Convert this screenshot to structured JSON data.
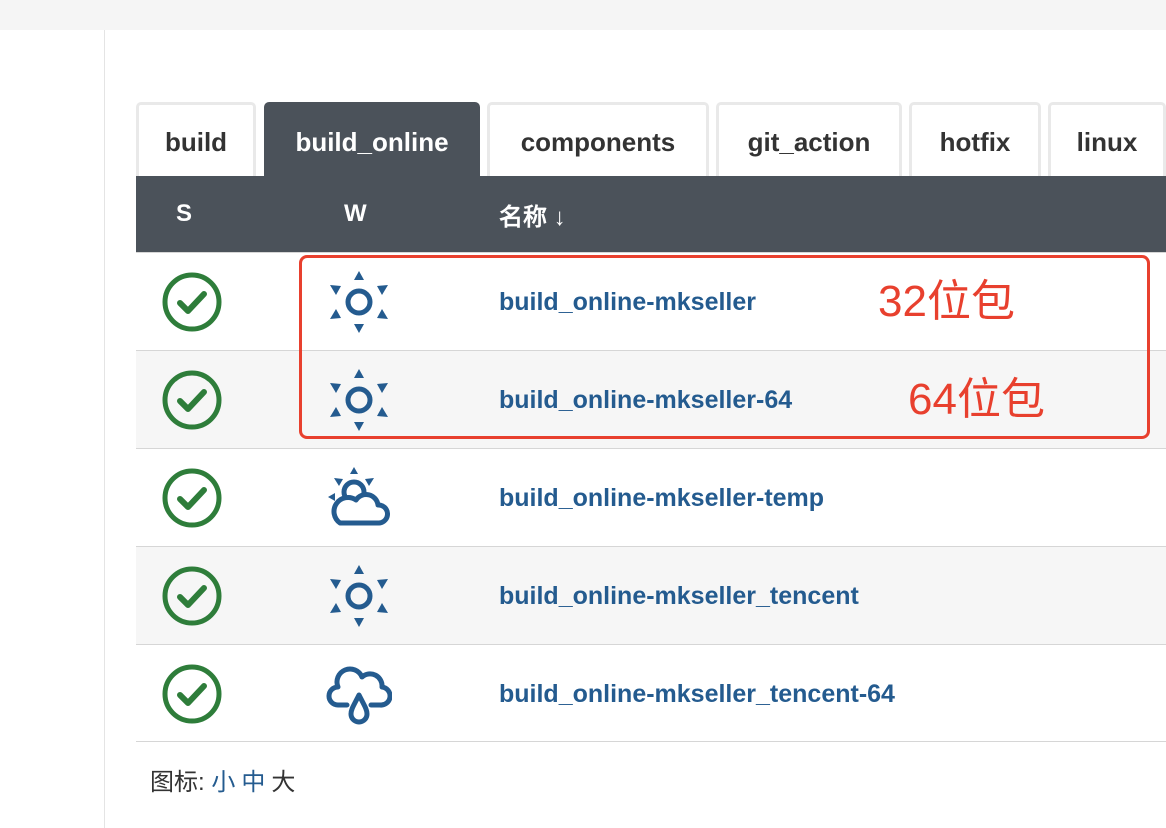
{
  "tabs": [
    "build",
    "build_online",
    "components",
    "git_action",
    "hotfix",
    "linux"
  ],
  "active_tab": "build_online",
  "table": {
    "columns": {
      "status": "S",
      "weather": "W",
      "name": "名称 ↓"
    },
    "rows": [
      {
        "status": "success",
        "weather_icon": "sunny-icon",
        "name": "build_online-mkseller"
      },
      {
        "status": "success",
        "weather_icon": "sunny-icon",
        "name": "build_online-mkseller-64"
      },
      {
        "status": "success",
        "weather_icon": "partly-cloudy-icon",
        "name": "build_online-mkseller-temp"
      },
      {
        "status": "success",
        "weather_icon": "sunny-icon",
        "name": "build_online-mkseller_tencent"
      },
      {
        "status": "success",
        "weather_icon": "rainy-icon",
        "name": "build_online-mkseller_tencent-64"
      }
    ]
  },
  "annotations": {
    "row1": "32位包",
    "row2": "64位包"
  },
  "footer": {
    "label": "图标:",
    "small": "小",
    "medium": "中",
    "large": "大"
  },
  "colors": {
    "header_bg": "#4b525a",
    "status_success": "#2e7d3a",
    "weather_icon": "#245b8f",
    "link": "#245b8f",
    "annotation": "#e8402e"
  }
}
